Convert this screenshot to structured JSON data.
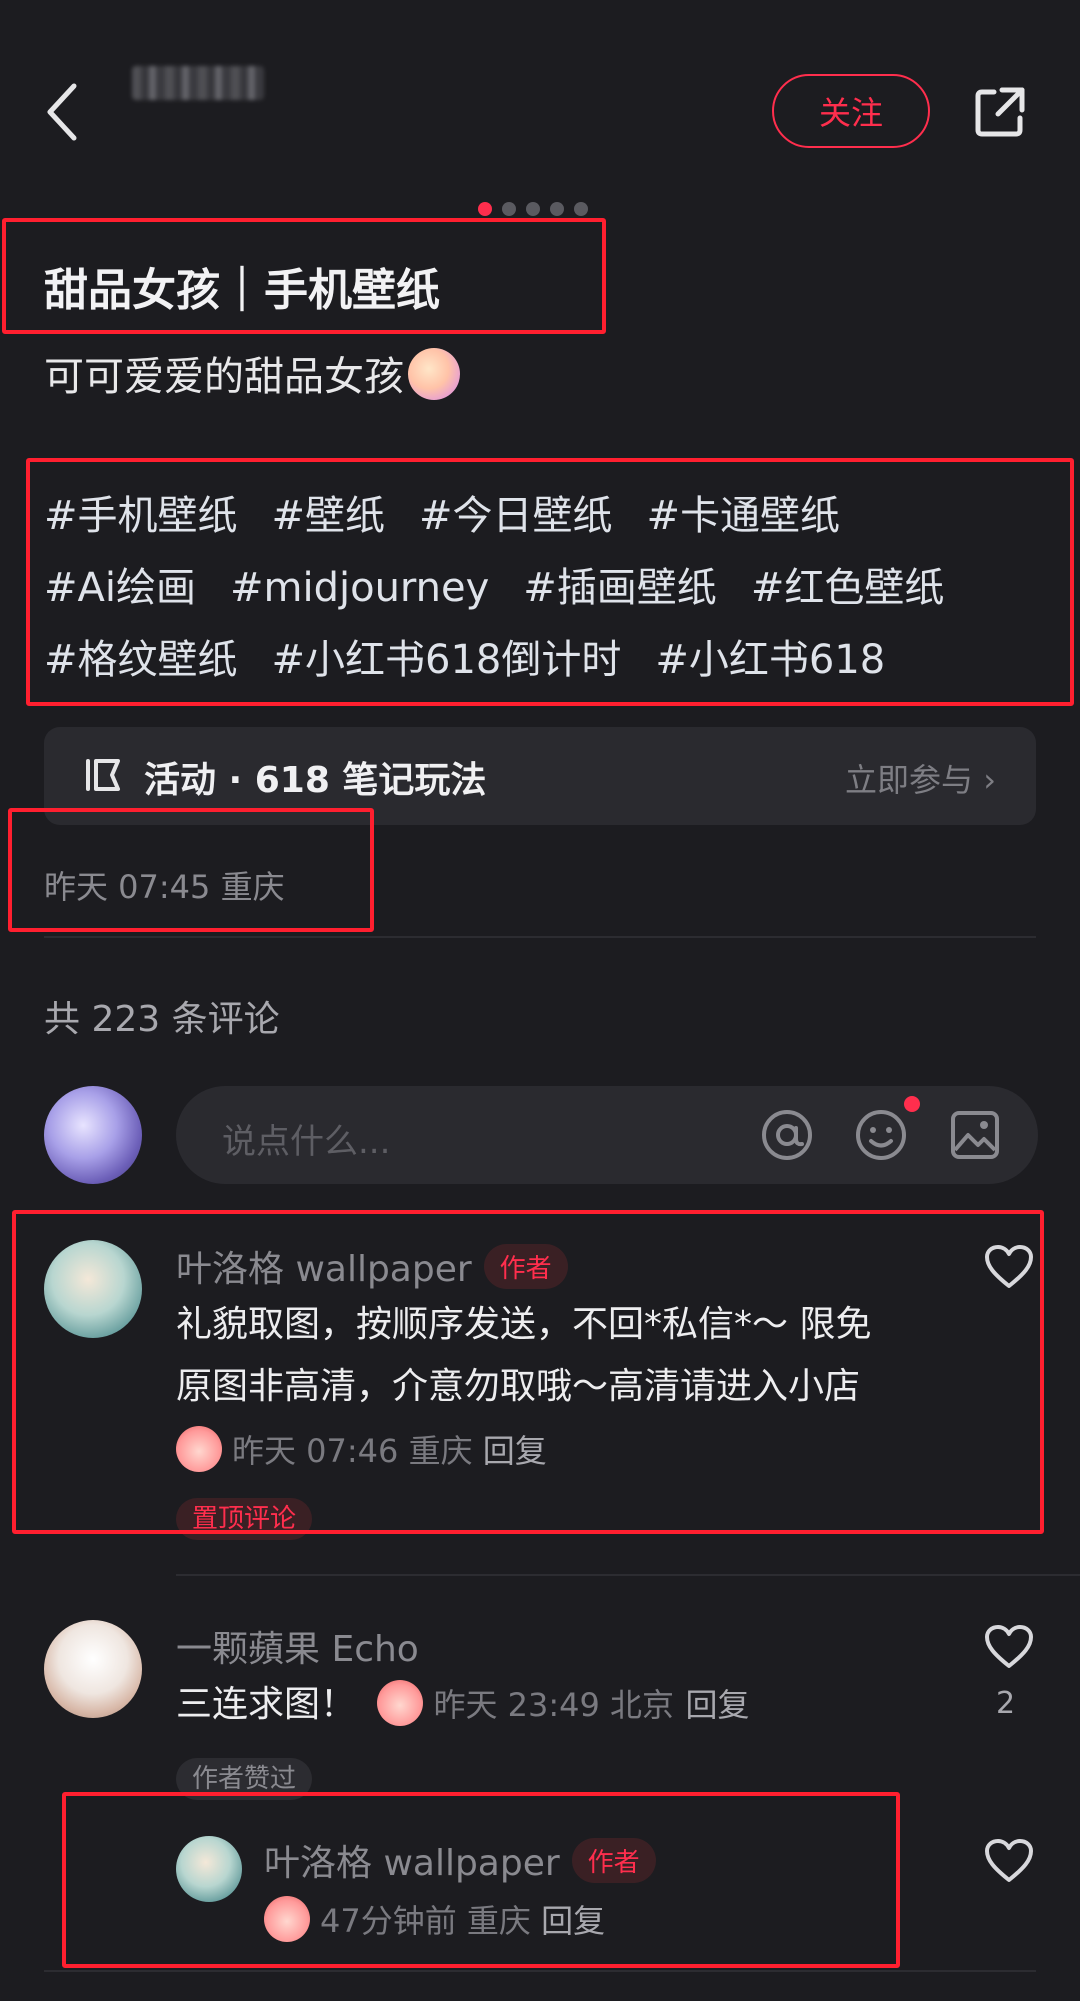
{
  "header": {
    "follow_label": "关注"
  },
  "carousel": {
    "total": 5,
    "active": 0
  },
  "post": {
    "title": "甜品女孩｜手机壁纸",
    "subtitle": "可可爱爱的甜品女孩",
    "tags": [
      "#手机壁纸",
      "#壁纸",
      "#今日壁纸",
      "#卡通壁纸",
      "#Ai绘画",
      "#midjourney",
      "#插画壁纸",
      "#红色壁纸",
      "#格纹壁纸",
      "#小红书618倒计时",
      "#小红书618"
    ],
    "time_location": "昨天 07:45 重庆"
  },
  "activity": {
    "label": "活动 · 618 笔记玩法",
    "join": "立即参与"
  },
  "comments_section": {
    "count_text": "共 223 条评论",
    "input_placeholder": "说点什么..."
  },
  "comments": [
    {
      "author": "叶洛格 wallpaper",
      "badge": "作者",
      "text_line1": "礼貌取图，按顺序发送，不回*私信*～ 限免",
      "text_line2": "原图非高清，介意勿取哦～高清请进入小店",
      "meta": "昨天 07:46 重庆",
      "reply": "回复",
      "tag": "置顶评论"
    },
    {
      "author": "一颗蘋果 Echo",
      "text": "三连求图！",
      "meta": "昨天 23:49 北京",
      "reply": "回复",
      "tag": "作者赞过",
      "likes": "2"
    },
    {
      "author": "叶洛格 wallpaper",
      "badge": "作者",
      "meta": "47分钟前 重庆",
      "reply": "回复"
    }
  ],
  "colors": {
    "accent": "#ff2e4d",
    "background": "#1c1c20",
    "highlight_box": "#ff1f2f"
  }
}
